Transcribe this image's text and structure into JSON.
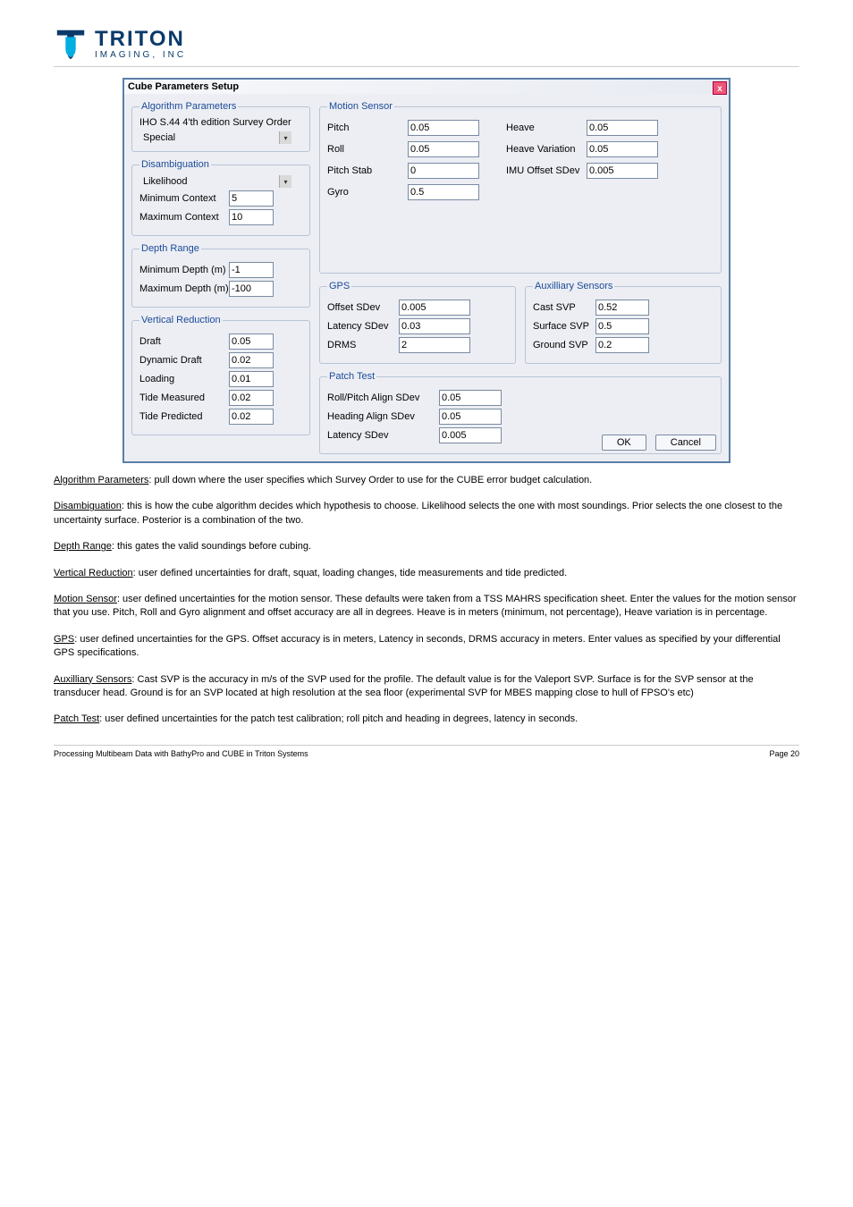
{
  "logo": {
    "line1": "TRITON",
    "line2": "IMAGING, INC"
  },
  "dialog": {
    "title": "Cube Parameters Setup",
    "close_label": "x",
    "algorithm": {
      "legend": "Algorithm Parameters",
      "iho_caption": "IHO S.44 4'th edition Survey Order",
      "iho_value": "Special"
    },
    "disambiguation": {
      "legend": "Disambiguation",
      "select_value": "Likelihood",
      "min_context_label": "Minimum Context",
      "min_context": "5",
      "max_context_label": "Maximum Context",
      "max_context": "10"
    },
    "depth_range": {
      "legend": "Depth Range",
      "min_label": "Minimum Depth (m)",
      "min": "-1",
      "max_label": "Maximum Depth (m)",
      "max": "-100"
    },
    "vertical_reduction": {
      "legend": "Vertical Reduction",
      "draft_label": "Draft",
      "draft": "0.05",
      "dyn_label": "Dynamic Draft",
      "dyn": "0.02",
      "loading_label": "Loading",
      "loading": "0.01",
      "tide_m_label": "Tide Measured",
      "tide_m": "0.02",
      "tide_p_label": "Tide Predicted",
      "tide_p": "0.02"
    },
    "motion": {
      "legend": "Motion Sensor",
      "pitch_label": "Pitch",
      "pitch": "0.05",
      "roll_label": "Roll",
      "roll": "0.05",
      "pitchstab_label": "Pitch Stab",
      "pitchstab": "0",
      "gyro_label": "Gyro",
      "gyro": "0.5",
      "heave_label": "Heave",
      "heave": "0.05",
      "heavevar_label": "Heave Variation",
      "heavevar": "0.05",
      "imu_label": "IMU Offset SDev",
      "imu": "0.005"
    },
    "gps": {
      "legend": "GPS",
      "offset_label": "Offset SDev",
      "offset": "0.005",
      "latency_label": "Latency SDev",
      "latency": "0.03",
      "drms_label": "DRMS",
      "drms": "2"
    },
    "aux": {
      "legend": "Auxilliary Sensors",
      "cast_label": "Cast SVP",
      "cast": "0.52",
      "surf_label": "Surface SVP",
      "surf": "0.5",
      "ground_label": "Ground SVP",
      "ground": "0.2"
    },
    "patch": {
      "legend": "Patch Test",
      "rp_label": "Roll/Pitch Align SDev",
      "rp": "0.05",
      "hd_label": "Heading Align SDev",
      "hd": "0.05",
      "lat_label": "Latency SDev",
      "lat": "0.005"
    },
    "ok_label": "OK",
    "cancel_label": "Cancel"
  },
  "descriptions": {
    "algo_u": "Algorithm Parameters",
    "algo_t": ": pull down where the user specifies which Survey Order to use for the CUBE error budget calculation.",
    "disamb_u": "Disambiguation",
    "disamb_t": ": this is how the cube algorithm decides which hypothesis to choose. Likelihood selects the one with most soundings. Prior selects the one closest to the uncertainty surface. Posterior is a combination of the two.",
    "depth_u": "Depth Range",
    "depth_t": ": this gates the valid soundings before cubing.",
    "vr_u": "Vertical Reduction",
    "vr_t": ": user defined uncertainties for draft, squat, loading changes, tide measurements and tide predicted.",
    "motion_u": "Motion Sensor",
    "motion_t": ": user defined uncertainties for the motion sensor. These defaults were taken from a TSS MAHRS specification sheet. Enter the values for the motion sensor that you use. Pitch, Roll and Gyro alignment and offset accuracy are all in degrees. Heave is in meters (minimum, not percentage), Heave variation is in percentage.",
    "gps_u": "GPS",
    "gps_t": ": user defined uncertainties for the GPS. Offset accuracy is in meters, Latency in seconds, DRMS accuracy in meters. Enter values as specified by your differential GPS specifications.",
    "aux_u": "Auxilliary Sensors",
    "aux_t": ": Cast SVP is the accuracy in m/s of the SVP used for the profile. The default value is for the Valeport SVP. Surface is for the SVP sensor at the transducer head. Ground is for an SVP located at high resolution at the sea floor (experimental SVP for MBES mapping close to hull of FPSO's etc)",
    "patch_u": "Patch Test",
    "patch_t": ": user defined uncertainties for the patch test calibration; roll pitch and heading in degrees, latency in seconds."
  },
  "footer": {
    "left": "Processing Multibeam Data with BathyPro and CUBE in Triton Systems",
    "right": "Page 20"
  }
}
